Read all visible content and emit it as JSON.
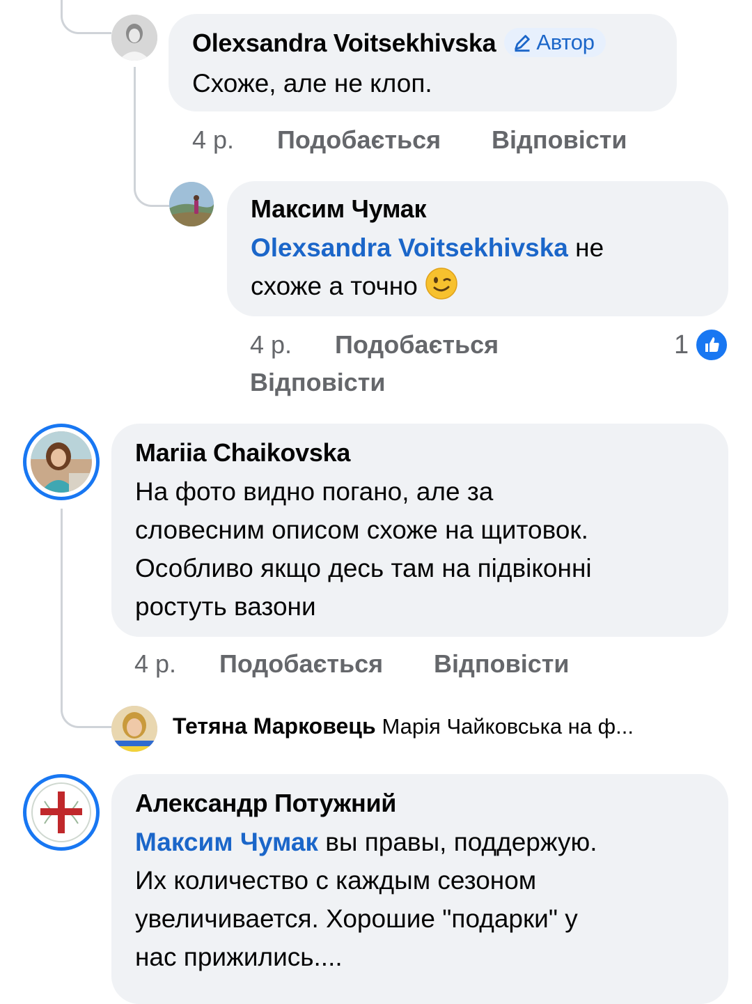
{
  "comments": [
    {
      "author": "Olexsandra Voitsekhivska",
      "badge": "Автор",
      "badge_icon": "pencil-icon",
      "text": "Схоже, але не клоп.",
      "time": "4 р.",
      "like_label": "Подобається",
      "reply_label": "Відповісти"
    },
    {
      "author": "Максим Чумак",
      "mention": "Olexsandra Voitsekhivska",
      "text_line1": "не",
      "text_line2": "схоже а точно",
      "emoji": "winking-face-icon",
      "time": "4 р.",
      "like_label": "Подобається",
      "reply_label": "Відповісти",
      "reaction_count": "1",
      "reaction_icon": "like-thumb-icon"
    },
    {
      "author": "Mariia Chaikovska",
      "text_lines": [
        "На фото видно погано, але за",
        "словесним описом схоже на щитовок.",
        "Особливо якщо десь там на підвіконні",
        "ростуть вазони"
      ],
      "time": "4 р.",
      "like_label": "Подобається",
      "reply_label": "Відповісти"
    },
    {
      "author": "Тетяна Марковець",
      "snippet": "Марія Чайковська на ф..."
    },
    {
      "author": "Александр Потужний",
      "mention": "Максим Чумак",
      "text_lines": [
        "вы правы, поддержую.",
        "Их количество с каждым сезоном",
        "увеличивается. Хорошие \"подарки\" у",
        "нас прижились...."
      ]
    }
  ],
  "colors": {
    "bubble": "#f0f2f5",
    "mention": "#1b66c9",
    "meta": "#65676b",
    "accent": "#1877f2",
    "thread_line": "#cfd3d8"
  }
}
